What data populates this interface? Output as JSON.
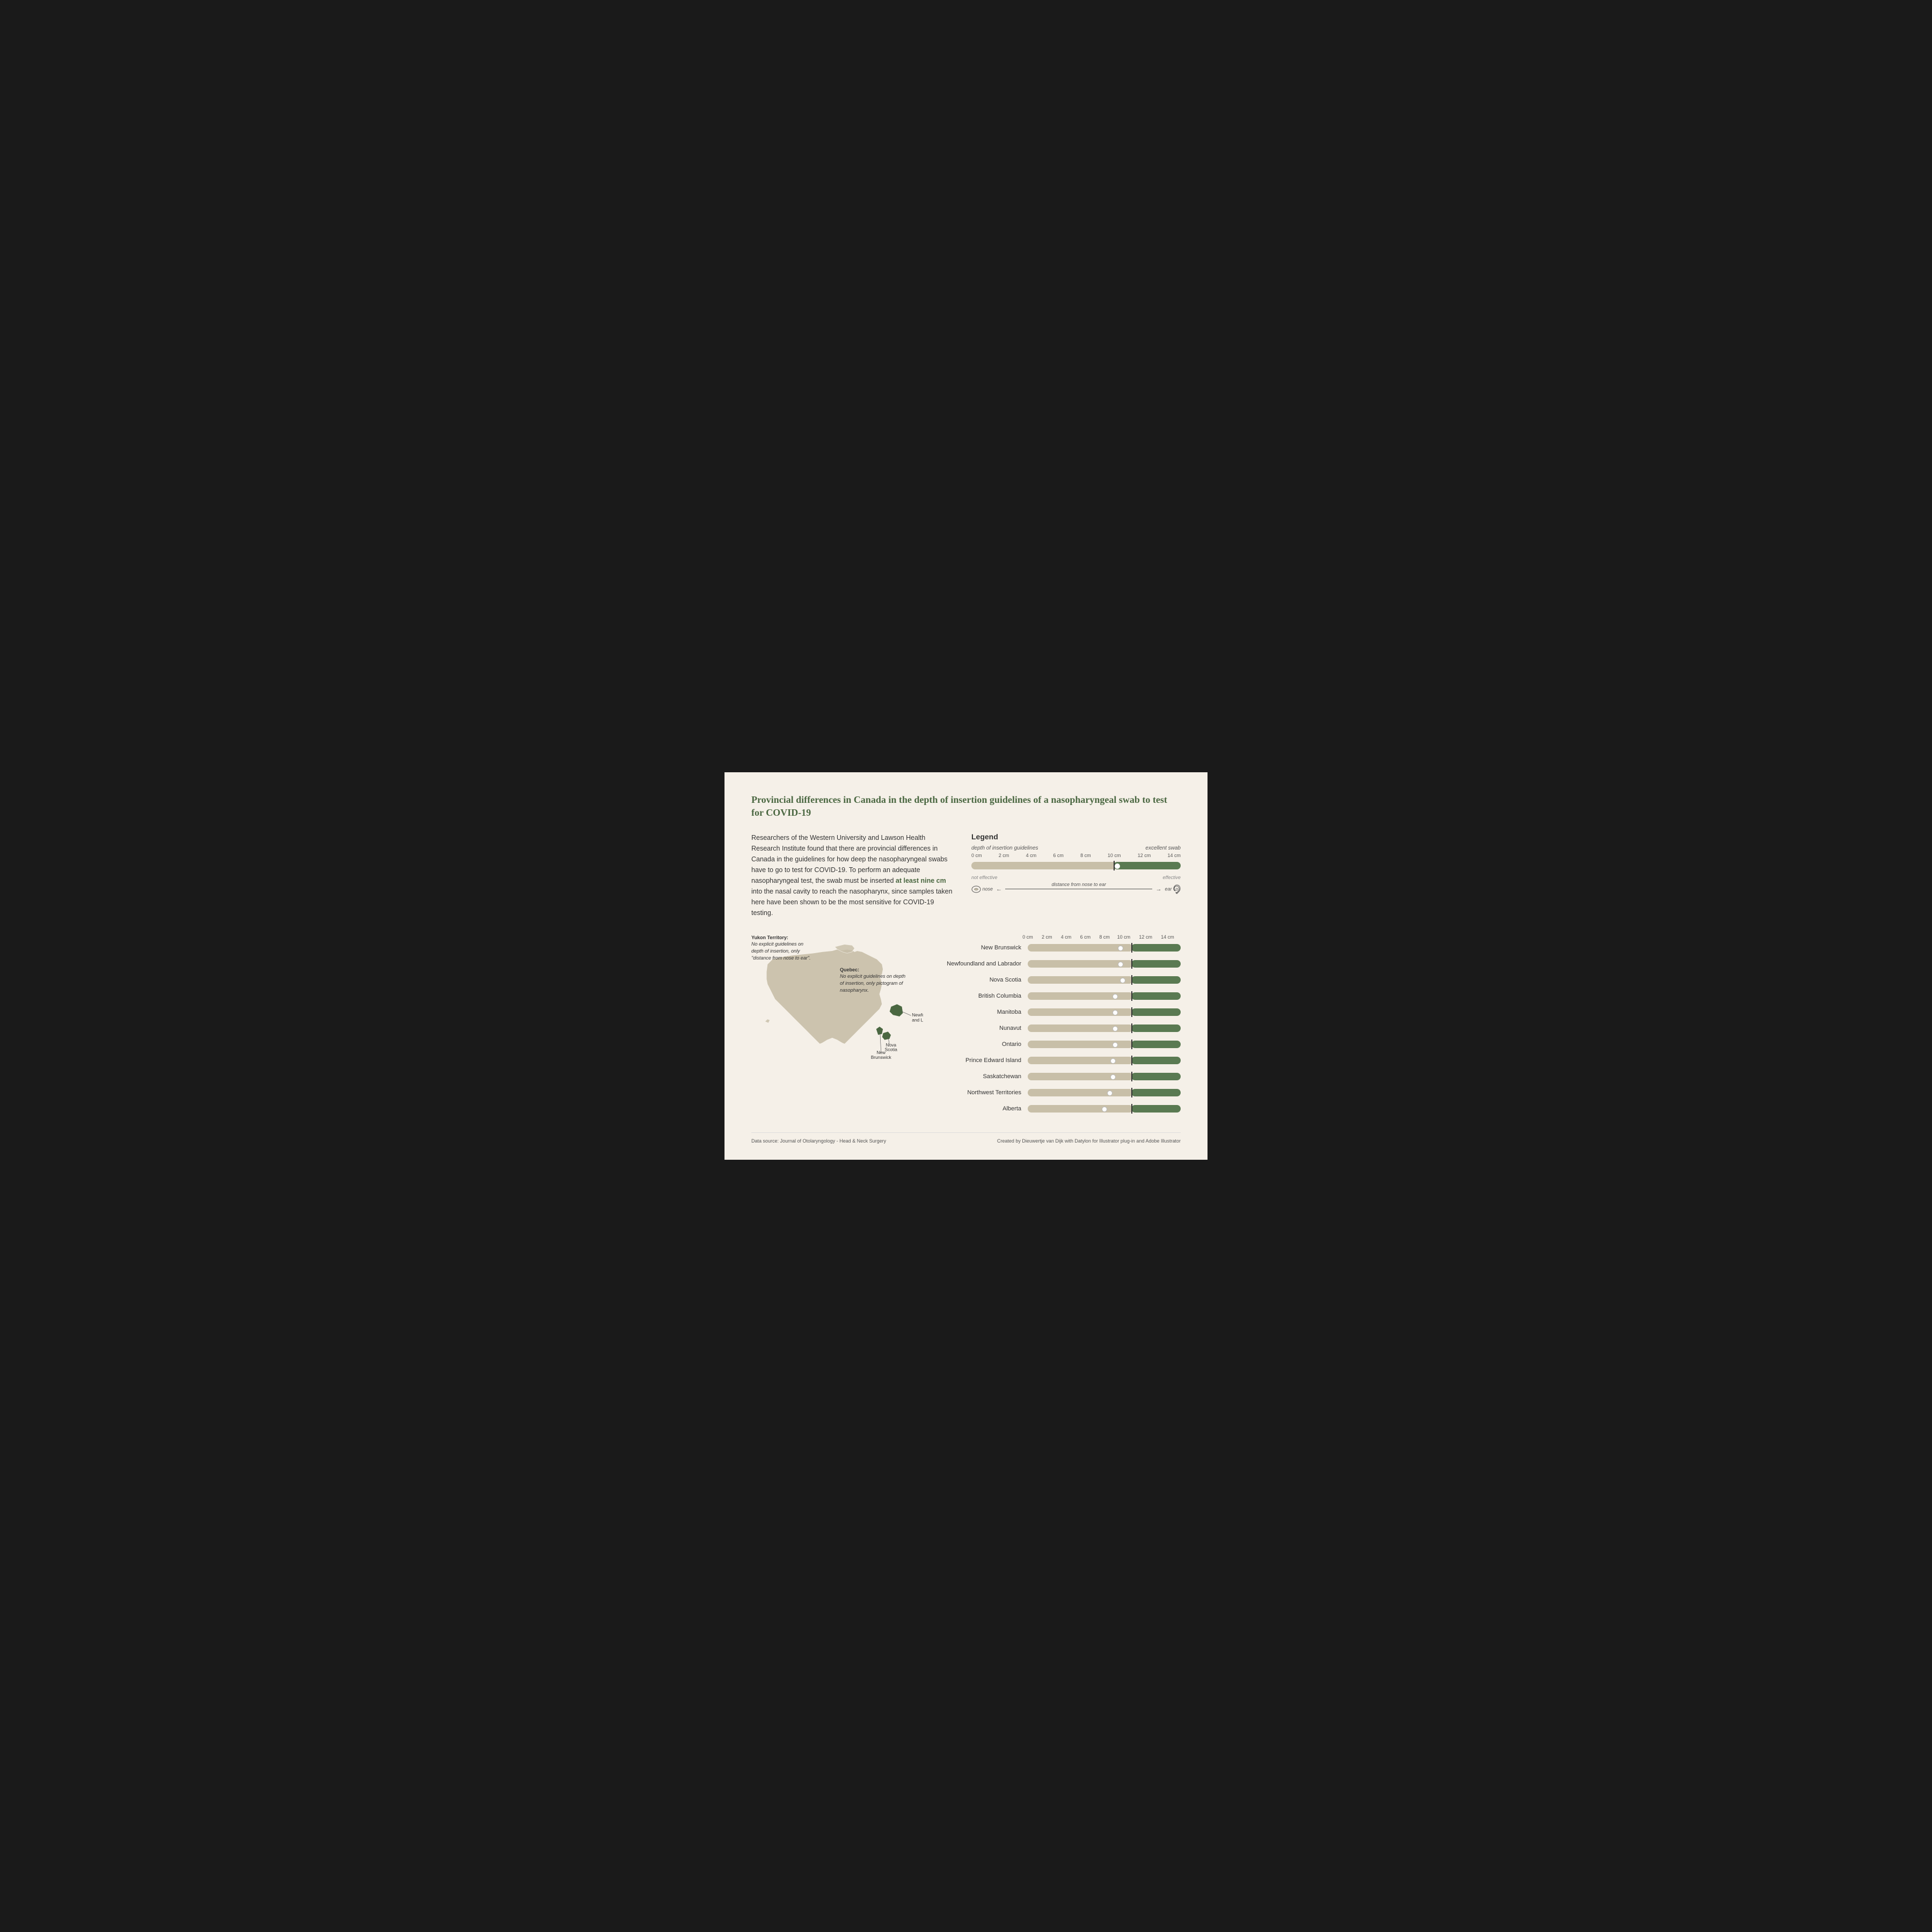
{
  "title": "Provincial differences in Canada in the depth of insertion guidelines of a nasopharyngeal swab to test for COVID-19",
  "intro": {
    "text1": "Researchers of the Western University and Lawson Health Research Institute found that there are provincial differences in Canada in the guidelines for how deep the nasopharyngeal swabs have to go to test for COVID-19. To perform an adequate nasopharyngeal test, the swab must be inserted ",
    "highlight": "at least nine cm",
    "text2": " into the nasal cavity to reach the nasopharynx, since samples taken here have been shown to be the most sensitive for COVID-19 testing."
  },
  "legend": {
    "title": "Legend",
    "depth_label": "depth of insertion guidelines",
    "excellent_label": "excellent swab",
    "not_effective": "not effective",
    "effective": "effective",
    "nose_label": "nose",
    "ear_label": "ear",
    "distance_label": "distance from nose to ear",
    "scale_labels": [
      "0 cm",
      "2 cm",
      "4 cm",
      "6 cm",
      "8 cm",
      "10 cm",
      "12 cm",
      "14 cm"
    ]
  },
  "annotations": {
    "yukon": {
      "title": "Yukon Territory:",
      "text": "No explicit guidelines on depth of insertion, only \"distance from nose to ear\"."
    },
    "quebec": {
      "title": "Quebec:",
      "text": "No explicit guidelines on depth of insertion, only pictogram of nasopharynx."
    },
    "newfoundland": "Newfoundland and Labrador",
    "nova_scotia": "Nova Scotia",
    "new_brunswick": "New Brunswick"
  },
  "chart": {
    "scale_labels": [
      "0 cm",
      "2 cm",
      "4 cm",
      "6 cm",
      "8 cm",
      "10 cm",
      "12 cm",
      "14 cm"
    ],
    "total_cm": 14,
    "marker_cm": 9.5,
    "provinces": [
      {
        "name": "New Brunswick",
        "swab_cm": 8.5,
        "marker_cm": 9.5
      },
      {
        "name": "Newfoundland and Labrador",
        "swab_cm": 8.5,
        "marker_cm": 9.5
      },
      {
        "name": "Nova Scotia",
        "swab_cm": 8.7,
        "marker_cm": 9.5
      },
      {
        "name": "British Columbia",
        "swab_cm": 8.0,
        "marker_cm": 9.5
      },
      {
        "name": "Manitoba",
        "swab_cm": 8.0,
        "marker_cm": 9.5
      },
      {
        "name": "Nunavut",
        "swab_cm": 8.0,
        "marker_cm": 9.5
      },
      {
        "name": "Ontario",
        "swab_cm": 8.0,
        "marker_cm": 9.5
      },
      {
        "name": "Prince Edward Island",
        "swab_cm": 7.8,
        "marker_cm": 9.5
      },
      {
        "name": "Saskatchewan",
        "swab_cm": 7.8,
        "marker_cm": 9.5
      },
      {
        "name": "Northwest Territories",
        "swab_cm": 7.5,
        "marker_cm": 9.5
      },
      {
        "name": "Alberta",
        "swab_cm": 7.0,
        "marker_cm": 9.5
      }
    ]
  },
  "footer": {
    "source": "Data source: Journal of Otolaryngology - Head & Neck Surgery",
    "credit": "Created by Dieuwertje van Dijk with Datylon for Illustrator plug-in and Adobe Illustrator"
  }
}
